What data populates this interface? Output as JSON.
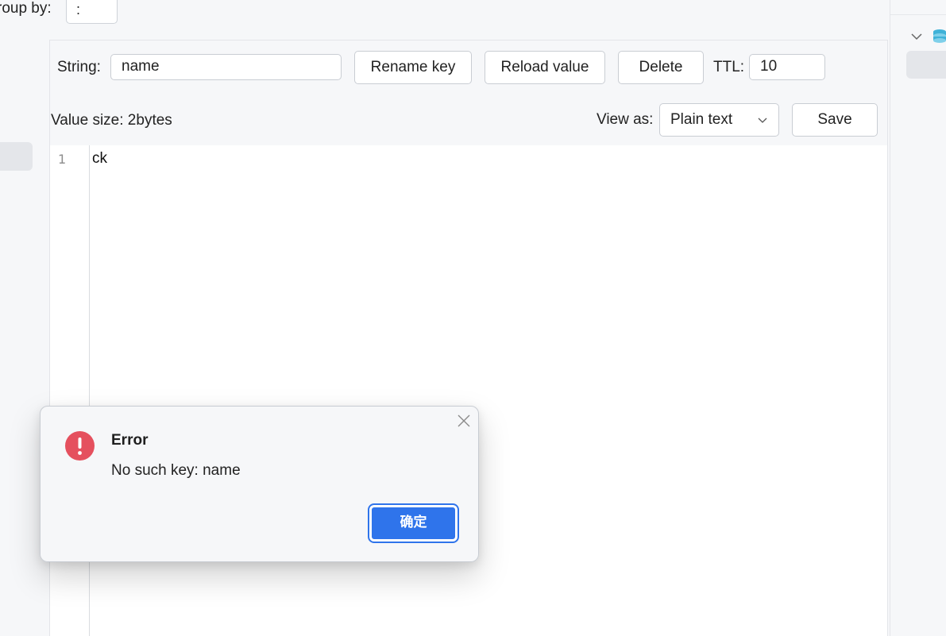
{
  "top": {
    "group_by_label": "roup by:",
    "group_by_value": ":"
  },
  "key_header": {
    "type_label": "String:",
    "key_name": "name",
    "rename_label": "Rename key",
    "reload_label": "Reload value",
    "delete_label": "Delete",
    "ttl_label": "TTL:",
    "ttl_value": "10"
  },
  "value_bar": {
    "size_text": "Value size: 2bytes",
    "view_as_label": "View as:",
    "view_as_value": "Plain text",
    "save_label": "Save"
  },
  "editor": {
    "lines": [
      {
        "number": "1",
        "text": "ck"
      }
    ]
  },
  "dialog": {
    "title": "Error",
    "message": "No such key: name",
    "ok_label": "确定",
    "accent": "#2f74eb",
    "error_color": "#e5505e"
  },
  "icons": [
    "chevron-down-icon",
    "database-icon",
    "close-icon",
    "error-icon"
  ]
}
